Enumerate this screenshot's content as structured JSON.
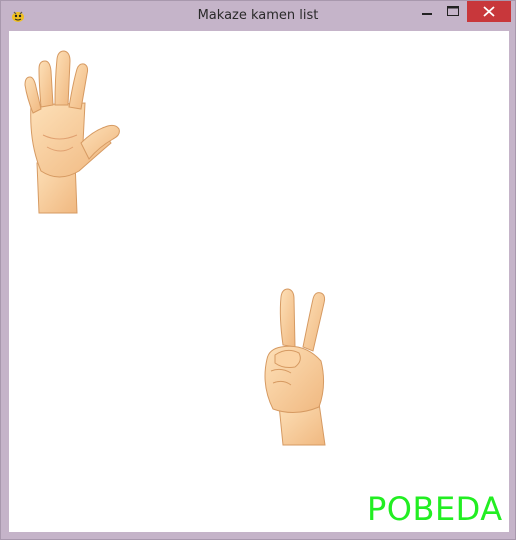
{
  "window": {
    "title": "Makaze kamen list",
    "icon": "pygame-snake-icon",
    "controls": [
      "minimize",
      "maximize",
      "close"
    ],
    "close_color": "#c8373b"
  },
  "game": {
    "player_hand": "paper-hand-icon",
    "opponent_hand": "scissors-hand-icon",
    "result_text": "POBEDA",
    "result_color": "#22ee22"
  }
}
